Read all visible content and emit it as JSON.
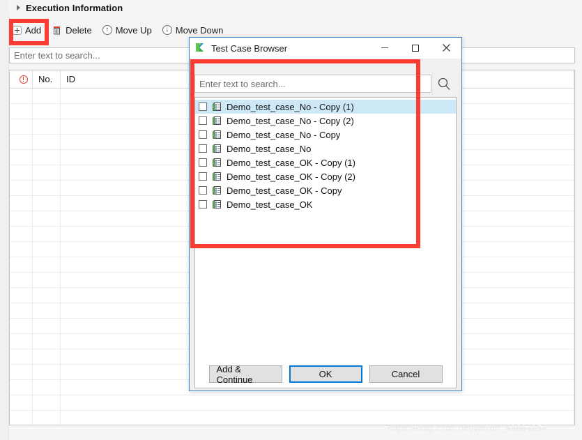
{
  "background": {
    "section_header": {
      "title": "Execution Information",
      "expander_icon": "triangle-right-icon"
    },
    "toolbar": [
      {
        "label": "Add",
        "icon": "plus-square-icon"
      },
      {
        "label": "Delete",
        "icon": "trash-icon"
      },
      {
        "label": "Move Up",
        "icon": "arrow-up-circle-icon"
      },
      {
        "label": "Move Down",
        "icon": "arrow-down-circle-icon"
      }
    ],
    "search": {
      "placeholder": "Enter text to search...",
      "value": ""
    },
    "table": {
      "columns": [
        "",
        "No.",
        "ID"
      ],
      "warning_icon": "exclamation-circle-icon",
      "rows": []
    },
    "watermark": "https://blog.csdn.net/weixin_43664254"
  },
  "dialog": {
    "title": "Test Case Browser",
    "app_icon": "katalon-k-logo-icon",
    "window_buttons": {
      "minimize": "minimize-icon",
      "maximize": "maximize-icon",
      "close": "close-icon"
    },
    "search": {
      "placeholder": "Enter text to search...",
      "value": "",
      "icon": "search-icon"
    },
    "list": {
      "item_icon": "test-case-icon",
      "items": [
        {
          "label": "Demo_test_case_No - Copy (1)",
          "checked": false,
          "selected": true
        },
        {
          "label": "Demo_test_case_No - Copy (2)",
          "checked": false,
          "selected": false
        },
        {
          "label": "Demo_test_case_No - Copy",
          "checked": false,
          "selected": false
        },
        {
          "label": "Demo_test_case_No",
          "checked": false,
          "selected": false
        },
        {
          "label": "Demo_test_case_OK - Copy (1)",
          "checked": false,
          "selected": false
        },
        {
          "label": "Demo_test_case_OK - Copy (2)",
          "checked": false,
          "selected": false
        },
        {
          "label": "Demo_test_case_OK - Copy",
          "checked": false,
          "selected": false
        },
        {
          "label": "Demo_test_case_OK",
          "checked": false,
          "selected": false
        }
      ]
    },
    "buttons": {
      "add_continue": "Add & Continue",
      "ok": "OK",
      "cancel": "Cancel"
    }
  },
  "annotations": {
    "color": "#fa3c33",
    "boxes": [
      {
        "name": "add-button-highlight"
      },
      {
        "name": "test-case-list-highlight"
      }
    ]
  }
}
